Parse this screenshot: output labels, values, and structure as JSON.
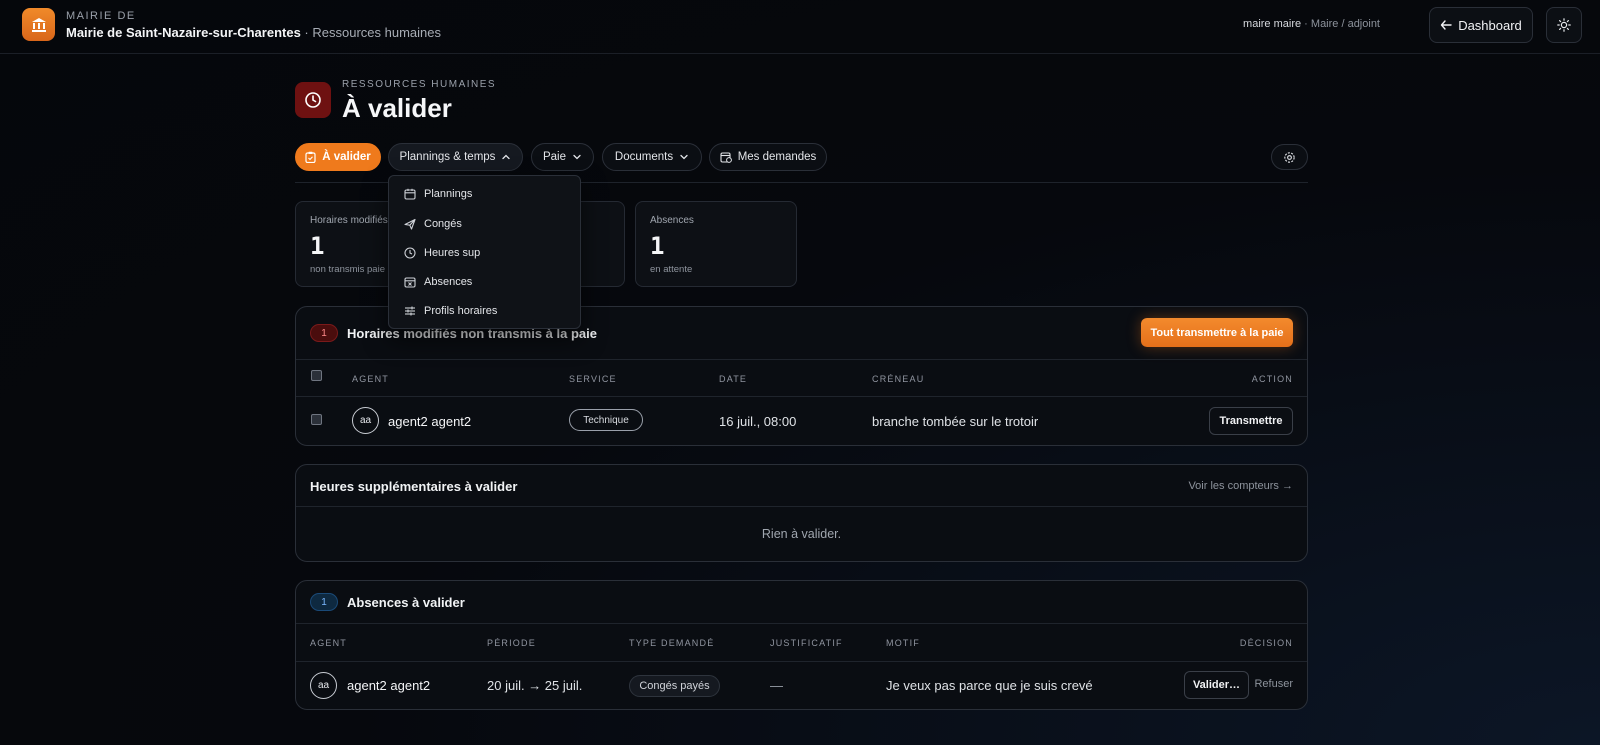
{
  "header": {
    "org_kicker": "MAIRIE DE",
    "org_name": "Mairie de Saint-Nazaire-sur-Charentes",
    "org_sep": " · ",
    "org_section": "Ressources humaines",
    "user_name": "maire maire",
    "user_role": " · Maire / adjoint",
    "dashboard_label": "Dashboard"
  },
  "page": {
    "kicker": "RESSOURCES HUMAINES",
    "title": "À valider"
  },
  "tabs": [
    {
      "label": "À valider",
      "icon": "clipboard-icon",
      "active": true
    },
    {
      "label": "Plannings & temps",
      "icon": "chevron-up-icon",
      "open": true
    },
    {
      "label": "Paie",
      "icon": "chevron-down-icon"
    },
    {
      "label": "Documents",
      "icon": "chevron-down-icon"
    },
    {
      "label": "Mes demandes",
      "icon": "calendar-clock-icon"
    }
  ],
  "dropdown": {
    "items": [
      {
        "label": "Plannings",
        "icon": "calendar-icon"
      },
      {
        "label": "Congés",
        "icon": "plane-icon"
      },
      {
        "label": "Heures sup",
        "icon": "clock-icon"
      },
      {
        "label": "Absences",
        "icon": "calendar-x-icon"
      },
      {
        "label": "Profils horaires",
        "icon": "sliders-icon"
      }
    ]
  },
  "stats": [
    {
      "label": "Horaires modifiés",
      "value": "1",
      "sub": "non transmis paie"
    },
    {
      "label": "Absences",
      "value": "1",
      "sub": "en attente"
    }
  ],
  "panel_horaires": {
    "badge": "1",
    "title": "Horaires modifiés non transmis à la paie",
    "action_all": "Tout transmettre à la paie",
    "columns": [
      "AGENT",
      "SERVICE",
      "DATE",
      "CRÉNEAU",
      "ACTION"
    ],
    "rows": [
      {
        "initials": "aa",
        "agent": "agent2 agent2",
        "service": "Technique",
        "date": "16 juil., 08:00",
        "creneau": "branche tombée sur le trotoir",
        "action": "Transmettre"
      }
    ]
  },
  "panel_heures": {
    "title": "Heures supplémentaires à valider",
    "link": "Voir les compteurs →",
    "empty": "Rien à valider."
  },
  "panel_absences": {
    "badge": "1",
    "title": "Absences à valider",
    "columns": [
      "AGENT",
      "PÉRIODE",
      "TYPE DEMANDÉ",
      "JUSTIFICATIF",
      "MOTIF",
      "DÉCISION"
    ],
    "rows": [
      {
        "initials": "aa",
        "agent": "agent2 agent2",
        "periode": "20 juil. → 25 juil.",
        "type": "Congés payés",
        "justificatif": "—",
        "motif": "Je veux pas parce que je suis crevé",
        "validate": "Valider…",
        "refuse": "Refuser"
      }
    ]
  },
  "colors": {
    "accent": "#ef7a1c",
    "danger_bg": "#6e1111",
    "background": "#06080d"
  }
}
